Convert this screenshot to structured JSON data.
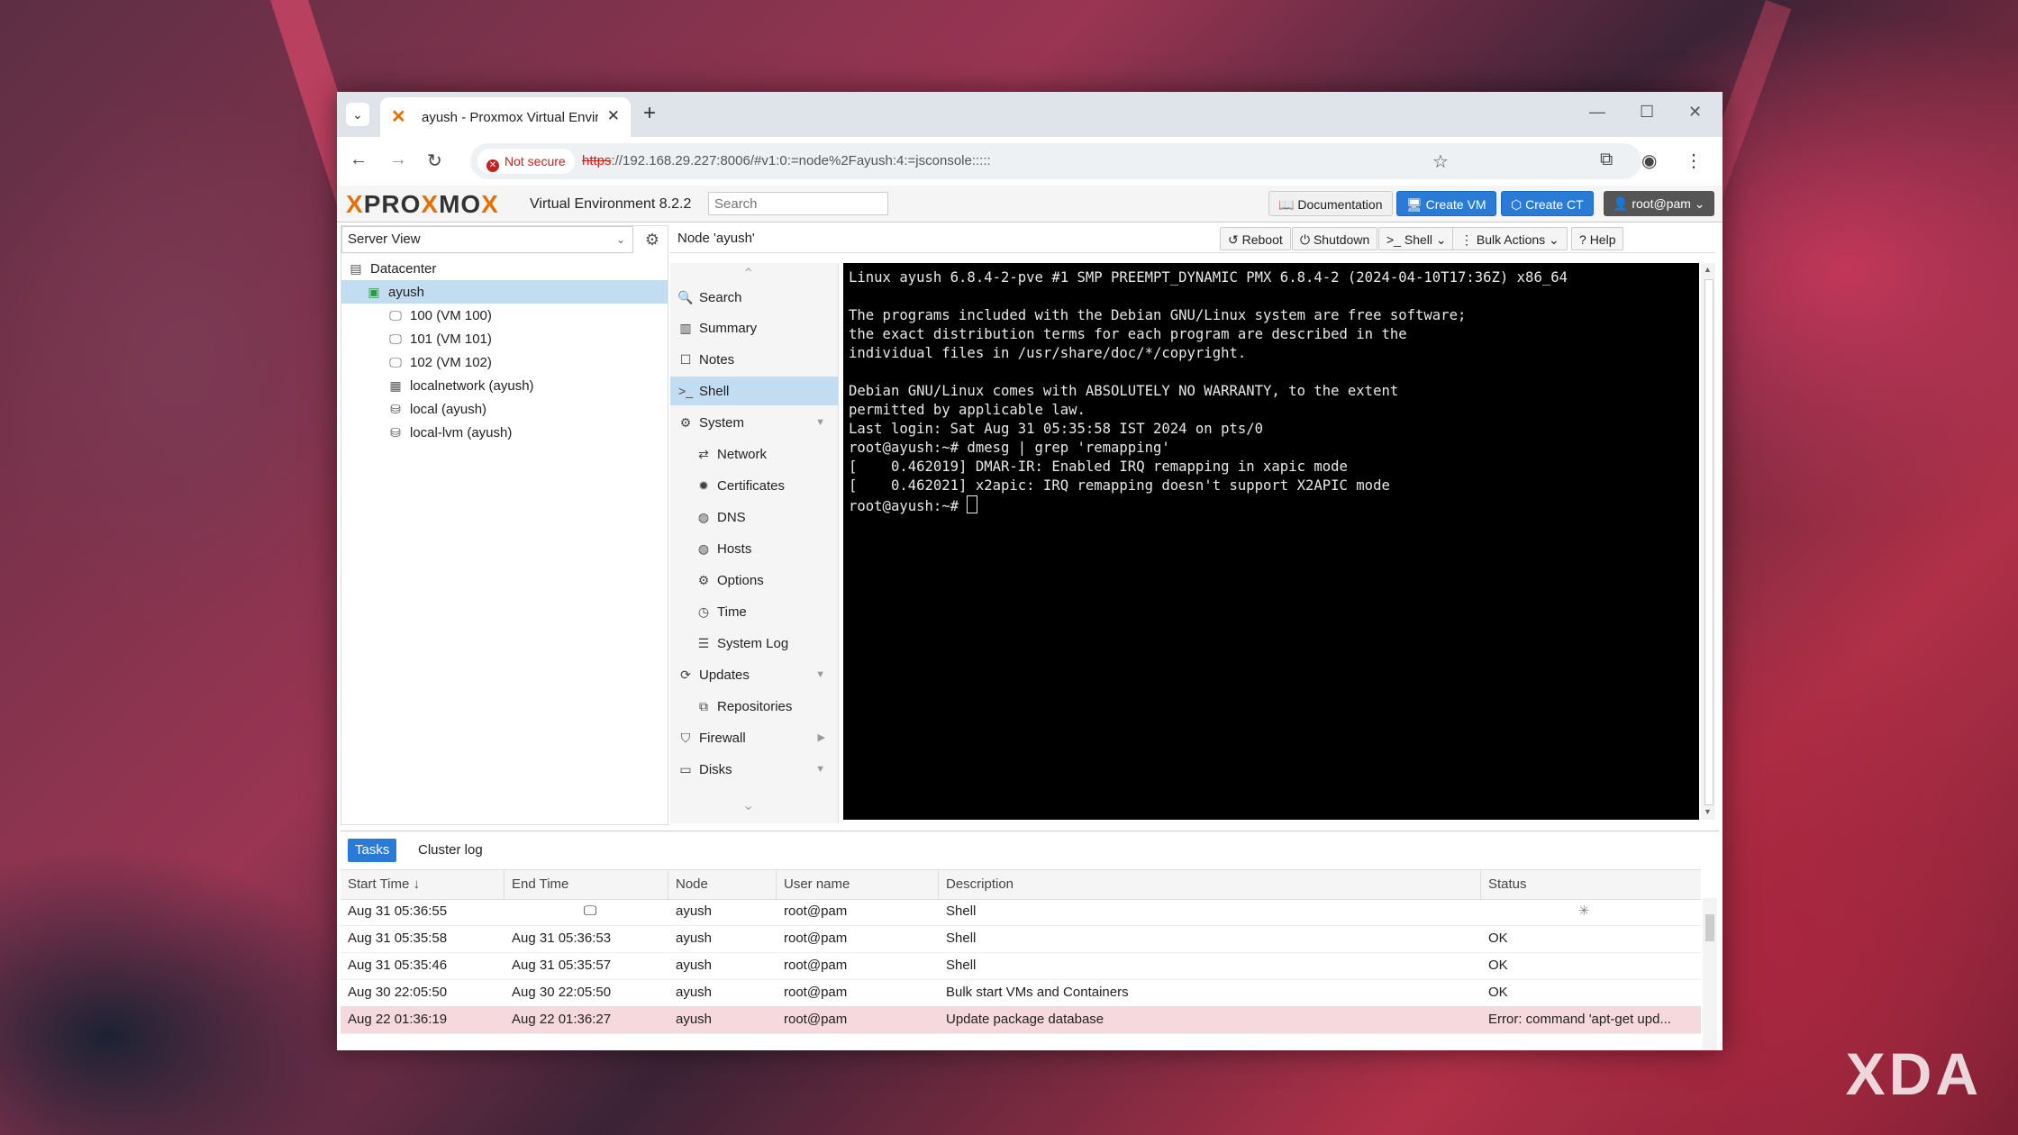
{
  "browser": {
    "tab_title": "ayush - Proxmox Virtual Environment",
    "security_label": "Not secure",
    "url_scheme": "https",
    "url_rest": "://192.168.29.227:8006/#v1:0:=node%2Fayush:4:=jsconsole:::::"
  },
  "header": {
    "logo_text_1": "PRO",
    "logo_text_2": "MO",
    "version": "Virtual Environment 8.2.2",
    "search_placeholder": "Search",
    "documentation": "Documentation",
    "create_vm": "Create VM",
    "create_ct": "Create CT",
    "user": "root@pam"
  },
  "tree": {
    "view": "Server View",
    "items": [
      {
        "label": "Datacenter"
      },
      {
        "label": "ayush"
      },
      {
        "label": "100 (VM 100)"
      },
      {
        "label": "101 (VM 101)"
      },
      {
        "label": "102 (VM 102)"
      },
      {
        "label": "localnetwork (ayush)"
      },
      {
        "label": "local (ayush)"
      },
      {
        "label": "local-lvm (ayush)"
      }
    ]
  },
  "node": {
    "title": "Node 'ayush'",
    "reboot": "Reboot",
    "shutdown": "Shutdown",
    "shell": "Shell",
    "bulk_actions": "Bulk Actions",
    "help": "Help"
  },
  "menu": {
    "items": [
      {
        "label": "Search"
      },
      {
        "label": "Summary"
      },
      {
        "label": "Notes"
      },
      {
        "label": "Shell"
      },
      {
        "label": "System"
      },
      {
        "label": "Network"
      },
      {
        "label": "Certificates"
      },
      {
        "label": "DNS"
      },
      {
        "label": "Hosts"
      },
      {
        "label": "Options"
      },
      {
        "label": "Time"
      },
      {
        "label": "System Log"
      },
      {
        "label": "Updates"
      },
      {
        "label": "Repositories"
      },
      {
        "label": "Firewall"
      },
      {
        "label": "Disks"
      }
    ]
  },
  "terminal": {
    "lines": [
      "Linux ayush 6.8.4-2-pve #1 SMP PREEMPT_DYNAMIC PMX 6.8.4-2 (2024-04-10T17:36Z) x86_64",
      "",
      "The programs included with the Debian GNU/Linux system are free software;",
      "the exact distribution terms for each program are described in the",
      "individual files in /usr/share/doc/*/copyright.",
      "",
      "Debian GNU/Linux comes with ABSOLUTELY NO WARRANTY, to the extent",
      "permitted by applicable law.",
      "Last login: Sat Aug 31 05:35:58 IST 2024 on pts/0",
      "root@ayush:~# dmesg | grep 'remapping'",
      "[    0.462019] DMAR-IR: Enabled IRQ remapping in xapic mode",
      "[    0.462021] x2apic: IRQ remapping doesn't support X2APIC mode",
      "root@ayush:~# "
    ]
  },
  "tasks": {
    "tab_tasks": "Tasks",
    "tab_cluster": "Cluster log",
    "columns": [
      "Start Time ↓",
      "End Time",
      "Node",
      "User name",
      "Description",
      "Status"
    ],
    "rows": [
      {
        "start": "Aug 31 05:36:55",
        "end": "",
        "node": "ayush",
        "user": "root@pam",
        "desc": "Shell",
        "status": ""
      },
      {
        "start": "Aug 31 05:35:58",
        "end": "Aug 31 05:36:53",
        "node": "ayush",
        "user": "root@pam",
        "desc": "Shell",
        "status": "OK"
      },
      {
        "start": "Aug 31 05:35:46",
        "end": "Aug 31 05:35:57",
        "node": "ayush",
        "user": "root@pam",
        "desc": "Shell",
        "status": "OK"
      },
      {
        "start": "Aug 30 22:05:50",
        "end": "Aug 30 22:05:50",
        "node": "ayush",
        "user": "root@pam",
        "desc": "Bulk start VMs and Containers",
        "status": "OK"
      },
      {
        "start": "Aug 22 01:36:19",
        "end": "Aug 22 01:36:27",
        "node": "ayush",
        "user": "root@pam",
        "desc": "Update package database",
        "status": "Error: command 'apt-get upd..."
      }
    ]
  },
  "watermark": "XDA"
}
